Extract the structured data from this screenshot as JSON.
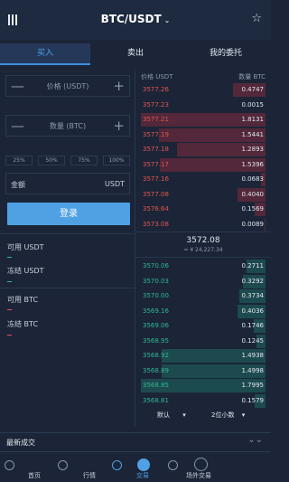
{
  "header": {
    "pair": "BTC/USDT",
    "chevron": "⌄",
    "star": "☆"
  },
  "tabs": [
    {
      "label": "买入"
    },
    {
      "label": "卖出"
    },
    {
      "label": "我的委托"
    }
  ],
  "form": {
    "price_placeholder": "价格 (USDT)",
    "qty_placeholder": "数量 (BTC)",
    "minus": "—",
    "plus": "+",
    "percents": [
      "25%",
      "50%",
      "75%",
      "100%"
    ],
    "amount_label": "金额",
    "amount_unit": "USDT",
    "login_button": "登录"
  },
  "balances": {
    "avail_usdt": "可用 USDT",
    "frozen_usdt": "冻结 USDT",
    "avail_btc": "可用 BTC",
    "frozen_btc": "冻结 BTC",
    "dash_colors": [
      "#2fb894",
      "#2fb894",
      "#e2554f",
      "#e2554f"
    ]
  },
  "orderbook": {
    "header_price": "价格 USDT",
    "header_qty": "数量 BTC",
    "asks": [
      {
        "price": "3577.26",
        "qty": "0.4747"
      },
      {
        "price": "3577.23",
        "qty": "0.0015"
      },
      {
        "price": "3577.21",
        "qty": "1.8131"
      },
      {
        "price": "3577.19",
        "qty": "1.5441"
      },
      {
        "price": "3577.18",
        "qty": "1.2893"
      },
      {
        "price": "3577.17",
        "qty": "1.5396"
      },
      {
        "price": "3577.16",
        "qty": "0.0683"
      },
      {
        "price": "3577.08",
        "qty": "0.4040"
      },
      {
        "price": "3576.64",
        "qty": "0.1569"
      },
      {
        "price": "3573.08",
        "qty": "0.0089"
      }
    ],
    "last_price": "3572.08",
    "last_price_cny": "≈ ¥ 24,227.34",
    "bids": [
      {
        "price": "3570.06",
        "qty": "0.2711"
      },
      {
        "price": "3570.03",
        "qty": "0.3292"
      },
      {
        "price": "3570.00",
        "qty": "0.3734"
      },
      {
        "price": "3569.16",
        "qty": "0.4036"
      },
      {
        "price": "3569.06",
        "qty": "0.1746"
      },
      {
        "price": "3568.95",
        "qty": "0.1245"
      },
      {
        "price": "3568.92",
        "qty": "1.4938"
      },
      {
        "price": "3568.89",
        "qty": "1.4998"
      },
      {
        "price": "3568.85",
        "qty": "1.7995"
      },
      {
        "price": "3568.81",
        "qty": "0.1579"
      }
    ],
    "mode": "默认",
    "decimals": "2位小数",
    "arrow": "▾"
  },
  "recent_trades": {
    "title": "最新成交",
    "chevron": "⌄⌄"
  },
  "nav": [
    {
      "label": "首页"
    },
    {
      "label": "行情"
    },
    {
      "label": "交易"
    },
    {
      "label": "场外交易"
    }
  ],
  "colors": {
    "accent": "#4fa1e4",
    "buy": "#2fb894",
    "sell": "#e2554f"
  }
}
